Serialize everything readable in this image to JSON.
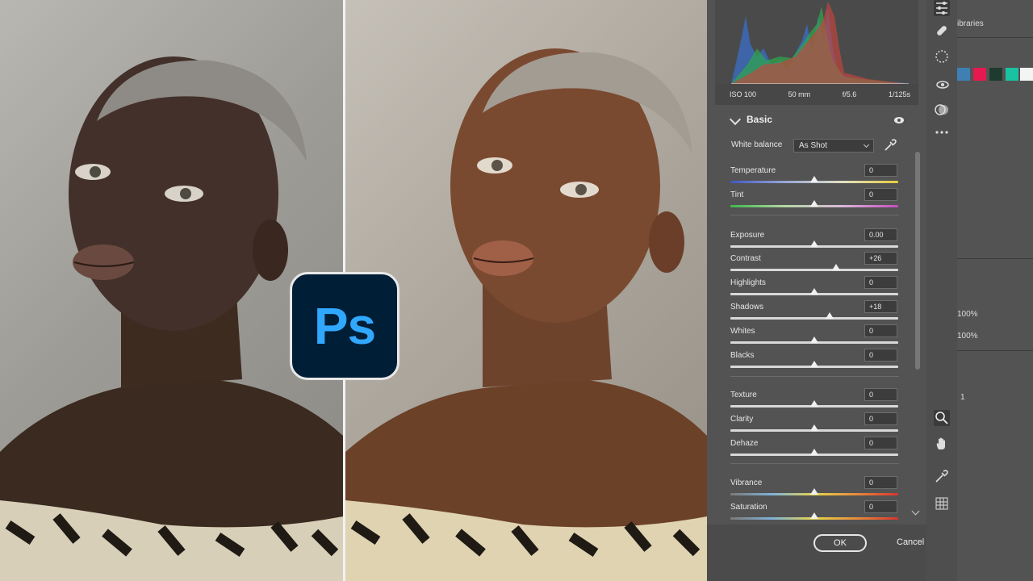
{
  "logo": {
    "text": "Ps"
  },
  "histogram": {
    "iso": "ISO 100",
    "focal": "50 mm",
    "aperture": "f/5.6",
    "shutter": "1/125s"
  },
  "basic": {
    "title": "Basic",
    "white_balance_label": "White balance",
    "white_balance_value": "As Shot"
  },
  "sliders": [
    {
      "label": "Temperature",
      "value": "0",
      "level": 0.5,
      "gradient": "temp"
    },
    {
      "label": "Tint",
      "value": "0",
      "level": 0.5,
      "gradient": "tint"
    },
    {
      "label": "Exposure",
      "value": "0.00",
      "level": 0.5,
      "gradient": "none"
    },
    {
      "label": "Contrast",
      "value": "+26",
      "level": 0.63,
      "gradient": "none"
    },
    {
      "label": "Highlights",
      "value": "0",
      "level": 0.5,
      "gradient": "none"
    },
    {
      "label": "Shadows",
      "value": "+18",
      "level": 0.59,
      "gradient": "none"
    },
    {
      "label": "Whites",
      "value": "0",
      "level": 0.5,
      "gradient": "none"
    },
    {
      "label": "Blacks",
      "value": "0",
      "level": 0.5,
      "gradient": "none"
    },
    {
      "label": "Texture",
      "value": "0",
      "level": 0.5,
      "gradient": "none"
    },
    {
      "label": "Clarity",
      "value": "0",
      "level": 0.5,
      "gradient": "none"
    },
    {
      "label": "Dehaze",
      "value": "0",
      "level": 0.5,
      "gradient": "none"
    },
    {
      "label": "Vibrance",
      "value": "0",
      "level": 0.5,
      "gradient": "sat"
    },
    {
      "label": "Saturation",
      "value": "0",
      "level": 0.5,
      "gradient": "sat"
    }
  ],
  "buttons": {
    "ok": "OK",
    "cancel": "Cancel"
  },
  "bg_panel": {
    "libraries": "ibraries",
    "opacity1": "100%",
    "opacity2": "100%",
    "layer_num": "1"
  },
  "colors": {
    "ps_blue": "#31a8ff",
    "ps_bg": "#001e36",
    "panel": "#535353",
    "swatches": [
      "#3f7fb4",
      "#e5194f",
      "#1f3b2f",
      "#19c2a1",
      "#f4f4f4"
    ]
  }
}
